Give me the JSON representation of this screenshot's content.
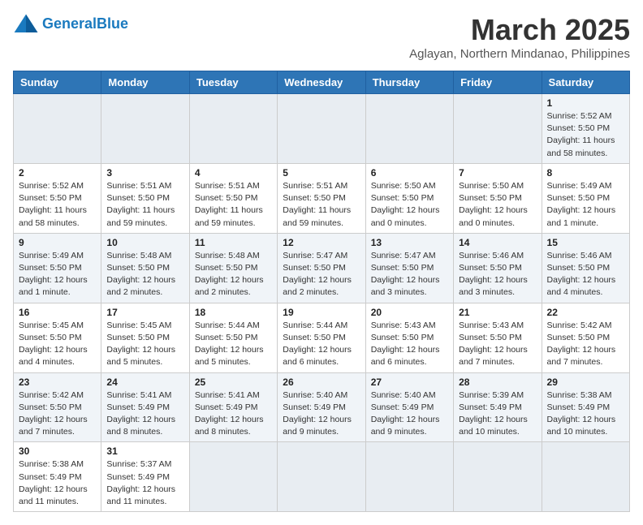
{
  "header": {
    "logo_general": "General",
    "logo_blue": "Blue",
    "title": "March 2025",
    "subtitle": "Aglayan, Northern Mindanao, Philippines"
  },
  "weekdays": [
    "Sunday",
    "Monday",
    "Tuesday",
    "Wednesday",
    "Thursday",
    "Friday",
    "Saturday"
  ],
  "weeks": [
    [
      {
        "day": "",
        "info": ""
      },
      {
        "day": "",
        "info": ""
      },
      {
        "day": "",
        "info": ""
      },
      {
        "day": "",
        "info": ""
      },
      {
        "day": "",
        "info": ""
      },
      {
        "day": "",
        "info": ""
      },
      {
        "day": "1",
        "info": "Sunrise: 5:52 AM\nSunset: 5:50 PM\nDaylight: 11 hours and 58 minutes."
      }
    ],
    [
      {
        "day": "2",
        "info": "Sunrise: 5:52 AM\nSunset: 5:50 PM\nDaylight: 11 hours and 58 minutes."
      },
      {
        "day": "3",
        "info": "Sunrise: 5:51 AM\nSunset: 5:50 PM\nDaylight: 11 hours and 59 minutes."
      },
      {
        "day": "4",
        "info": "Sunrise: 5:51 AM\nSunset: 5:50 PM\nDaylight: 11 hours and 59 minutes."
      },
      {
        "day": "5",
        "info": "Sunrise: 5:51 AM\nSunset: 5:50 PM\nDaylight: 11 hours and 59 minutes."
      },
      {
        "day": "6",
        "info": "Sunrise: 5:50 AM\nSunset: 5:50 PM\nDaylight: 12 hours and 0 minutes."
      },
      {
        "day": "7",
        "info": "Sunrise: 5:50 AM\nSunset: 5:50 PM\nDaylight: 12 hours and 0 minutes."
      },
      {
        "day": "8",
        "info": "Sunrise: 5:49 AM\nSunset: 5:50 PM\nDaylight: 12 hours and 1 minute."
      }
    ],
    [
      {
        "day": "9",
        "info": "Sunrise: 5:49 AM\nSunset: 5:50 PM\nDaylight: 12 hours and 1 minute."
      },
      {
        "day": "10",
        "info": "Sunrise: 5:48 AM\nSunset: 5:50 PM\nDaylight: 12 hours and 2 minutes."
      },
      {
        "day": "11",
        "info": "Sunrise: 5:48 AM\nSunset: 5:50 PM\nDaylight: 12 hours and 2 minutes."
      },
      {
        "day": "12",
        "info": "Sunrise: 5:47 AM\nSunset: 5:50 PM\nDaylight: 12 hours and 2 minutes."
      },
      {
        "day": "13",
        "info": "Sunrise: 5:47 AM\nSunset: 5:50 PM\nDaylight: 12 hours and 3 minutes."
      },
      {
        "day": "14",
        "info": "Sunrise: 5:46 AM\nSunset: 5:50 PM\nDaylight: 12 hours and 3 minutes."
      },
      {
        "day": "15",
        "info": "Sunrise: 5:46 AM\nSunset: 5:50 PM\nDaylight: 12 hours and 4 minutes."
      }
    ],
    [
      {
        "day": "16",
        "info": "Sunrise: 5:45 AM\nSunset: 5:50 PM\nDaylight: 12 hours and 4 minutes."
      },
      {
        "day": "17",
        "info": "Sunrise: 5:45 AM\nSunset: 5:50 PM\nDaylight: 12 hours and 5 minutes."
      },
      {
        "day": "18",
        "info": "Sunrise: 5:44 AM\nSunset: 5:50 PM\nDaylight: 12 hours and 5 minutes."
      },
      {
        "day": "19",
        "info": "Sunrise: 5:44 AM\nSunset: 5:50 PM\nDaylight: 12 hours and 6 minutes."
      },
      {
        "day": "20",
        "info": "Sunrise: 5:43 AM\nSunset: 5:50 PM\nDaylight: 12 hours and 6 minutes."
      },
      {
        "day": "21",
        "info": "Sunrise: 5:43 AM\nSunset: 5:50 PM\nDaylight: 12 hours and 7 minutes."
      },
      {
        "day": "22",
        "info": "Sunrise: 5:42 AM\nSunset: 5:50 PM\nDaylight: 12 hours and 7 minutes."
      }
    ],
    [
      {
        "day": "23",
        "info": "Sunrise: 5:42 AM\nSunset: 5:50 PM\nDaylight: 12 hours and 7 minutes."
      },
      {
        "day": "24",
        "info": "Sunrise: 5:41 AM\nSunset: 5:49 PM\nDaylight: 12 hours and 8 minutes."
      },
      {
        "day": "25",
        "info": "Sunrise: 5:41 AM\nSunset: 5:49 PM\nDaylight: 12 hours and 8 minutes."
      },
      {
        "day": "26",
        "info": "Sunrise: 5:40 AM\nSunset: 5:49 PM\nDaylight: 12 hours and 9 minutes."
      },
      {
        "day": "27",
        "info": "Sunrise: 5:40 AM\nSunset: 5:49 PM\nDaylight: 12 hours and 9 minutes."
      },
      {
        "day": "28",
        "info": "Sunrise: 5:39 AM\nSunset: 5:49 PM\nDaylight: 12 hours and 10 minutes."
      },
      {
        "day": "29",
        "info": "Sunrise: 5:38 AM\nSunset: 5:49 PM\nDaylight: 12 hours and 10 minutes."
      }
    ],
    [
      {
        "day": "30",
        "info": "Sunrise: 5:38 AM\nSunset: 5:49 PM\nDaylight: 12 hours and 11 minutes."
      },
      {
        "day": "31",
        "info": "Sunrise: 5:37 AM\nSunset: 5:49 PM\nDaylight: 12 hours and 11 minutes."
      },
      {
        "day": "",
        "info": ""
      },
      {
        "day": "",
        "info": ""
      },
      {
        "day": "",
        "info": ""
      },
      {
        "day": "",
        "info": ""
      },
      {
        "day": "",
        "info": ""
      }
    ]
  ]
}
